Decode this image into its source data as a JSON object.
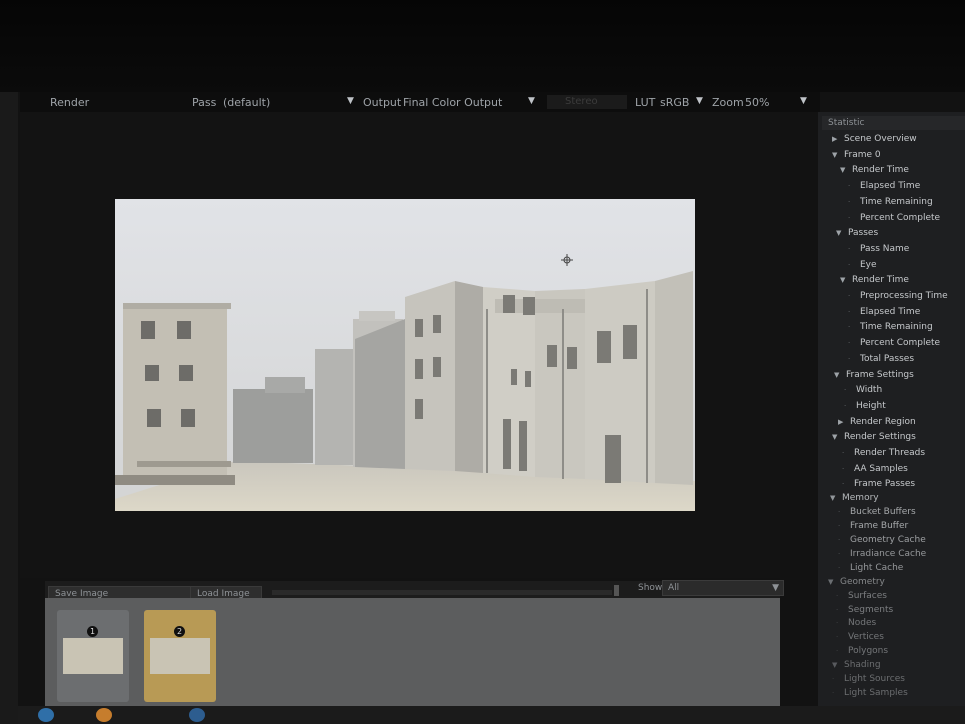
{
  "toolbar": {
    "render_label": "Render",
    "pass_label": "Pass",
    "pass_value": "(default)",
    "output_label": "Output",
    "output_value": "Final Color Output",
    "stereo_value": "Stereo",
    "lut_label": "LUT",
    "lut_value": "sRGB",
    "zoom_label": "Zoom",
    "zoom_value": "50%"
  },
  "bottom": {
    "save_image": "Save Image",
    "load_image": "Load Image",
    "show_label": "Show",
    "show_value": "All",
    "thumbs": [
      {
        "num": "1"
      },
      {
        "num": "2"
      }
    ]
  },
  "panel": {
    "title": "Statistic",
    "tree": [
      {
        "label": "Scene Overview",
        "expanded": false
      },
      {
        "label": "Frame 0",
        "expanded": true
      },
      {
        "label": "Render Time",
        "expanded": true
      },
      {
        "label": "Elapsed Time"
      },
      {
        "label": "Time Remaining"
      },
      {
        "label": "Percent Complete"
      },
      {
        "label": "Passes",
        "expanded": true
      },
      {
        "label": "Pass Name"
      },
      {
        "label": "Eye"
      },
      {
        "label": "Render Time",
        "expanded": true
      },
      {
        "label": "Preprocessing Time"
      },
      {
        "label": "Elapsed Time"
      },
      {
        "label": "Time Remaining"
      },
      {
        "label": "Percent Complete"
      },
      {
        "label": "Total Passes"
      },
      {
        "label": "Frame Settings",
        "expanded": true
      },
      {
        "label": "Width"
      },
      {
        "label": "Height"
      },
      {
        "label": "Render Region",
        "expanded": false
      },
      {
        "label": "Render Settings",
        "expanded": true
      },
      {
        "label": "Render Threads"
      },
      {
        "label": "AA Samples"
      },
      {
        "label": "Frame Passes"
      },
      {
        "label": "Memory",
        "expanded": true
      },
      {
        "label": "Bucket Buffers"
      },
      {
        "label": "Frame Buffer"
      },
      {
        "label": "Geometry Cache"
      },
      {
        "label": "Irradiance Cache"
      },
      {
        "label": "Light Cache"
      },
      {
        "label": "Geometry",
        "expanded": true
      },
      {
        "label": "Surfaces"
      },
      {
        "label": "Segments"
      },
      {
        "label": "Nodes"
      },
      {
        "label": "Vertices"
      },
      {
        "label": "Polygons"
      },
      {
        "label": "Shading",
        "expanded": true
      },
      {
        "label": "Light Sources"
      },
      {
        "label": "Light Samples"
      }
    ]
  },
  "colors": {
    "background": "#060606",
    "panel": "#1e1f21",
    "thumb_selected": "#b89a55",
    "render_sky": "#e3e6ea"
  }
}
